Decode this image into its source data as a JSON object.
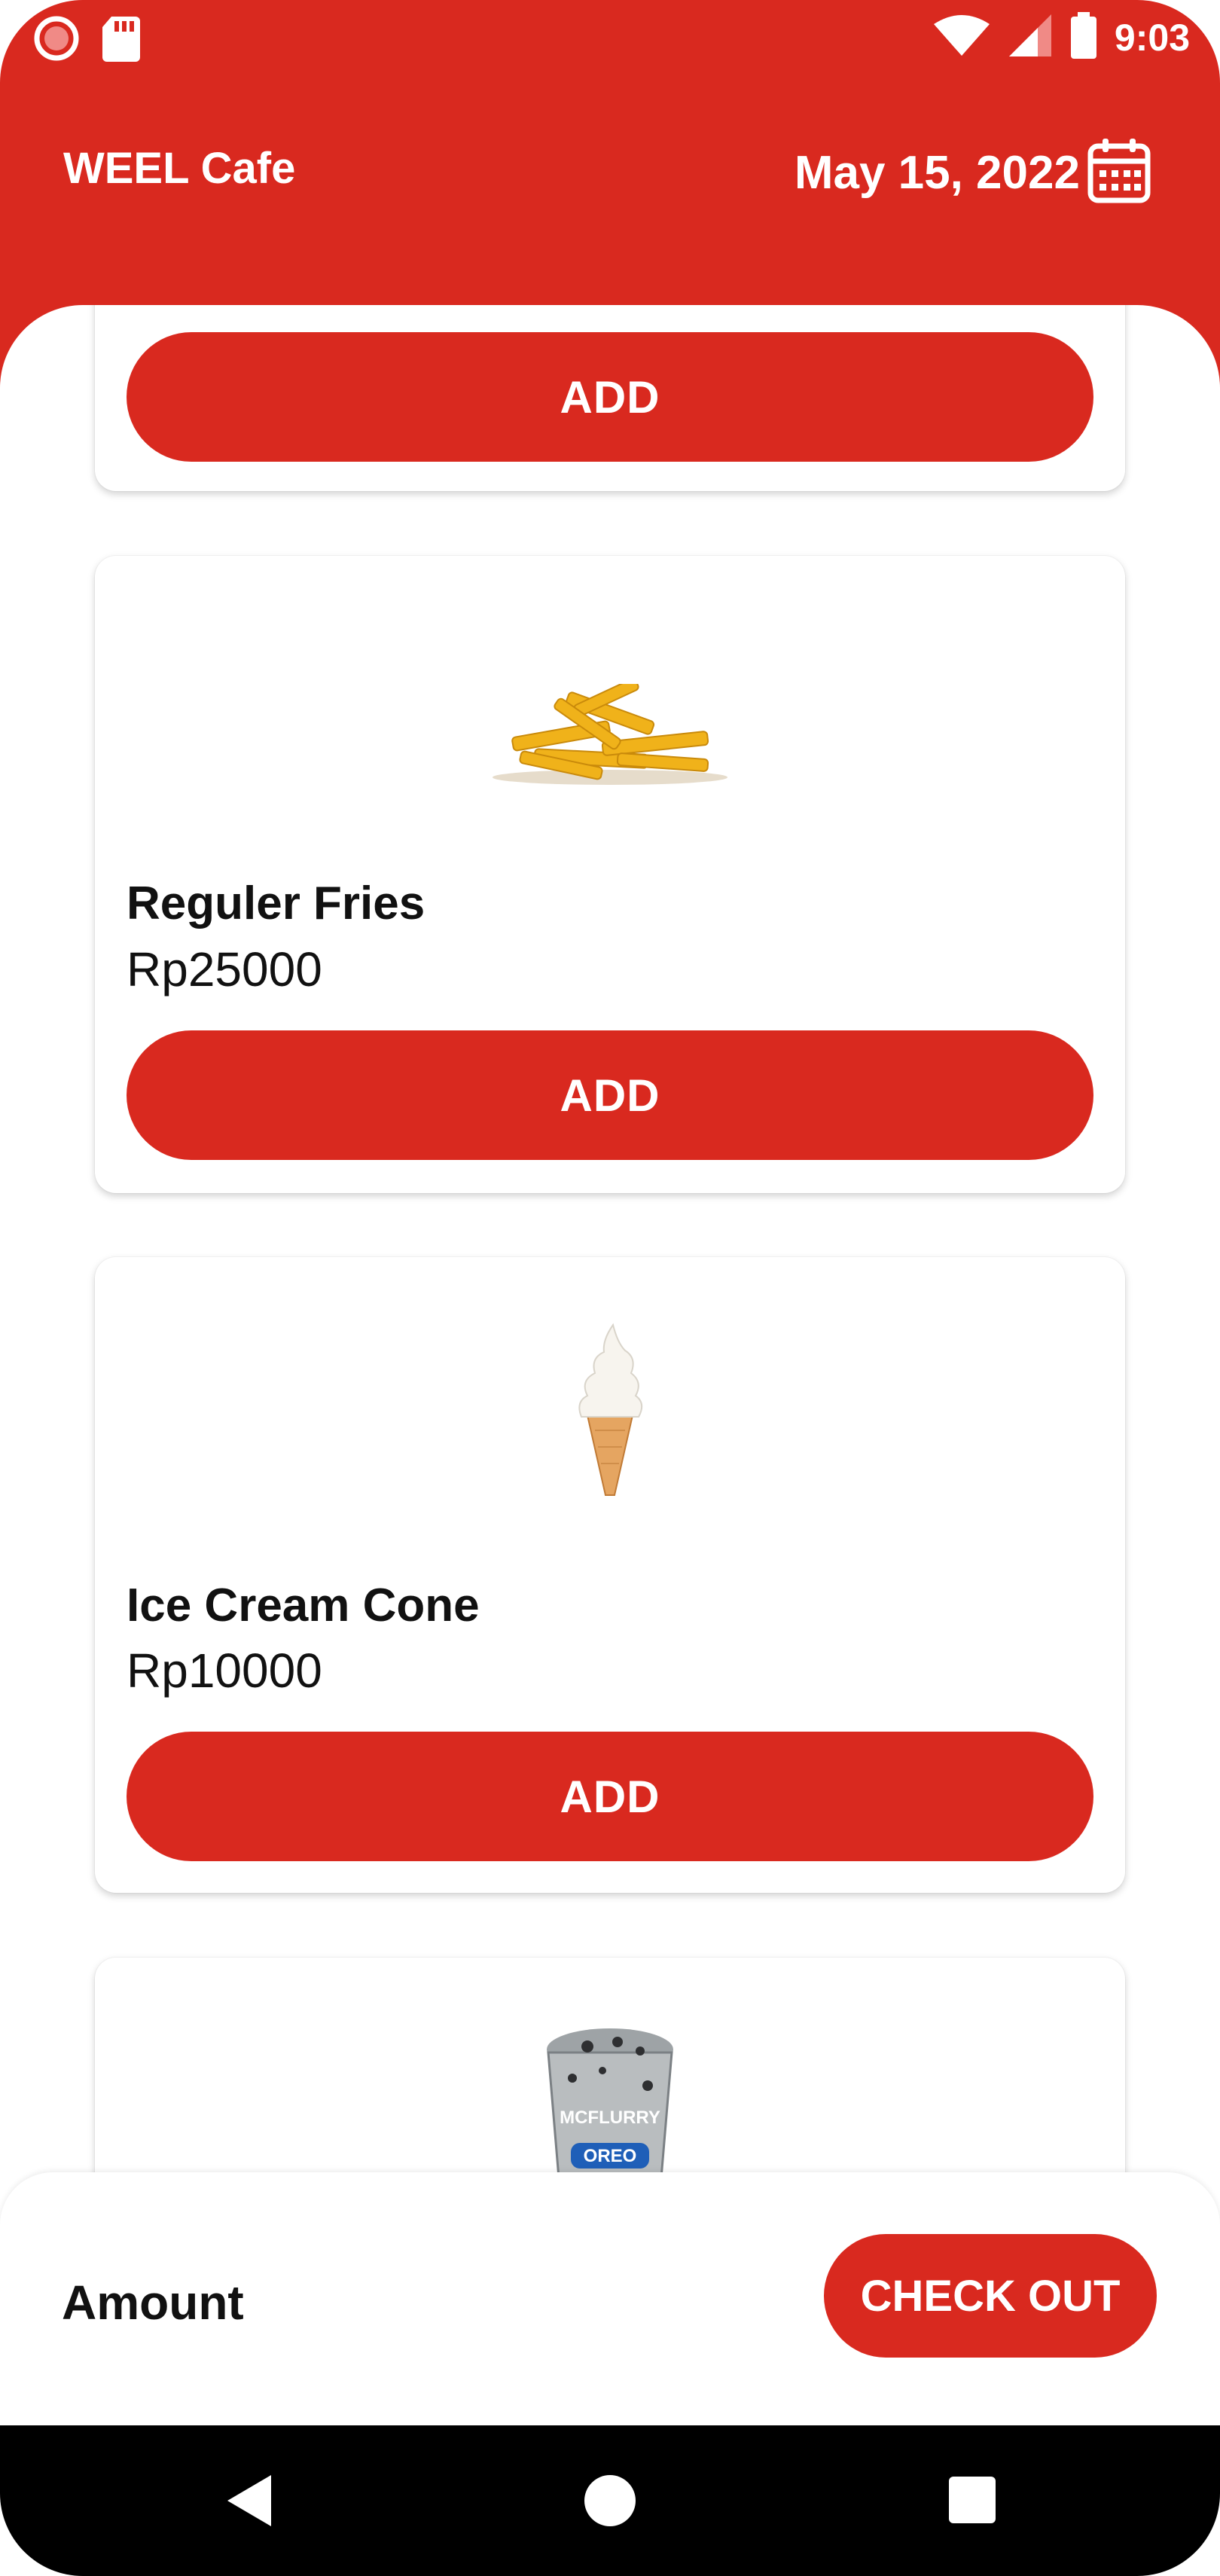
{
  "status_bar": {
    "time": "9:03",
    "icons": [
      "record-icon",
      "sd-card-icon",
      "wifi-icon",
      "signal-icon",
      "battery-icon"
    ]
  },
  "header": {
    "title": "WEEL Cafe",
    "date": "May 15, 2022",
    "calendar_icon": "calendar-icon"
  },
  "colors": {
    "accent": "#d9291f",
    "background": "#ffffff",
    "text": "#111111"
  },
  "products": [
    {
      "name": "",
      "price": "",
      "button_label": "ADD"
    },
    {
      "name": "Reguler Fries",
      "price": "Rp25000",
      "button_label": "ADD",
      "image": "fries-image"
    },
    {
      "name": "Ice Cream Cone",
      "price": "Rp10000",
      "button_label": "ADD",
      "image": "ice-cream-cone-image"
    },
    {
      "name": "",
      "price": "",
      "image": "mcflurry-oreo-image",
      "image_text": [
        "MCFLURRY",
        "OREO"
      ]
    }
  ],
  "footer": {
    "amount_label": "Amount",
    "checkout_label": "CHECK OUT"
  },
  "nav": [
    "back-icon",
    "home-icon",
    "recents-icon"
  ]
}
